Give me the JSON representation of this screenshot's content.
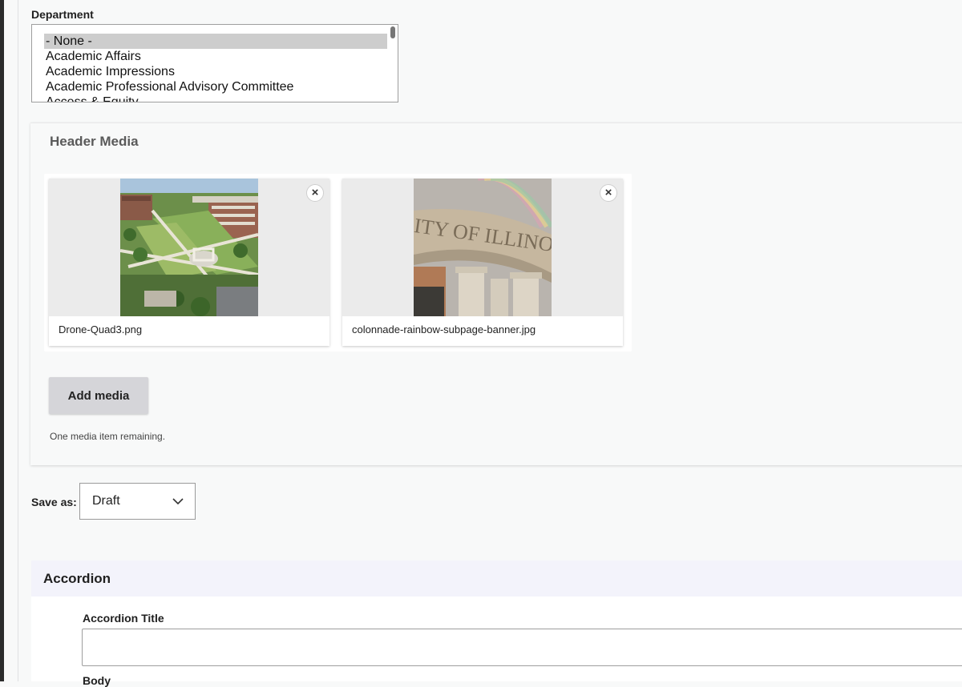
{
  "department": {
    "label": "Department",
    "options": [
      "- None -",
      "Academic Affairs",
      "Academic Impressions",
      "Academic Professional Advisory Committee",
      "Access & Equity"
    ],
    "selected": "- None -"
  },
  "header_media": {
    "title": "Header Media",
    "items": [
      {
        "filename": "Drone-Quad3.png",
        "remove_label": "×"
      },
      {
        "filename": "colonnade-rainbow-subpage-banner.jpg",
        "remove_label": "×"
      }
    ],
    "add_button": "Add media",
    "remaining_note": "One media item remaining."
  },
  "save_as": {
    "label": "Save as:",
    "value": "Draft"
  },
  "accordion": {
    "title": "Accordion",
    "title_field_label": "Accordion Title",
    "title_field_value": "",
    "body_label": "Body"
  },
  "colors": {
    "page_bg": "#f8f9f9",
    "accordion_header_bg": "#f3f3fb",
    "button_bg": "#d5d5d9",
    "selected_option_bg": "#cdcdcd"
  }
}
